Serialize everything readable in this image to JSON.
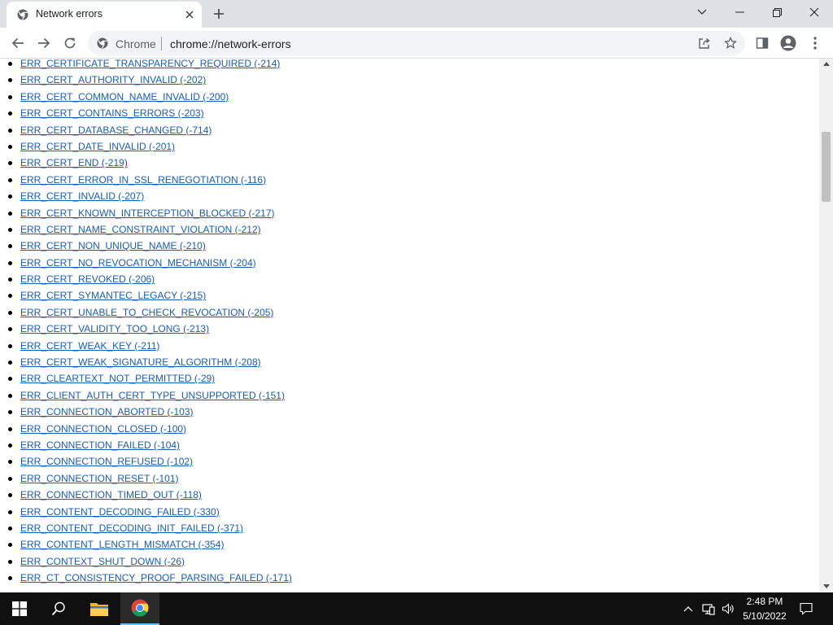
{
  "tab": {
    "title": "Network errors"
  },
  "toolbar": {
    "scheme_label": "Chrome",
    "url": "chrome://network-errors"
  },
  "errors": [
    "ERR_CERTIFICATE_TRANSPARENCY_REQUIRED (-214)",
    "ERR_CERT_AUTHORITY_INVALID (-202)",
    "ERR_CERT_COMMON_NAME_INVALID (-200)",
    "ERR_CERT_CONTAINS_ERRORS (-203)",
    "ERR_CERT_DATABASE_CHANGED (-714)",
    "ERR_CERT_DATE_INVALID (-201)",
    "ERR_CERT_END (-219)",
    "ERR_CERT_ERROR_IN_SSL_RENEGOTIATION (-116)",
    "ERR_CERT_INVALID (-207)",
    "ERR_CERT_KNOWN_INTERCEPTION_BLOCKED (-217)",
    "ERR_CERT_NAME_CONSTRAINT_VIOLATION (-212)",
    "ERR_CERT_NON_UNIQUE_NAME (-210)",
    "ERR_CERT_NO_REVOCATION_MECHANISM (-204)",
    "ERR_CERT_REVOKED (-206)",
    "ERR_CERT_SYMANTEC_LEGACY (-215)",
    "ERR_CERT_UNABLE_TO_CHECK_REVOCATION (-205)",
    "ERR_CERT_VALIDITY_TOO_LONG (-213)",
    "ERR_CERT_WEAK_KEY (-211)",
    "ERR_CERT_WEAK_SIGNATURE_ALGORITHM (-208)",
    "ERR_CLEARTEXT_NOT_PERMITTED (-29)",
    "ERR_CLIENT_AUTH_CERT_TYPE_UNSUPPORTED (-151)",
    "ERR_CONNECTION_ABORTED (-103)",
    "ERR_CONNECTION_CLOSED (-100)",
    "ERR_CONNECTION_FAILED (-104)",
    "ERR_CONNECTION_REFUSED (-102)",
    "ERR_CONNECTION_RESET (-101)",
    "ERR_CONNECTION_TIMED_OUT (-118)",
    "ERR_CONTENT_DECODING_FAILED (-330)",
    "ERR_CONTENT_DECODING_INIT_FAILED (-371)",
    "ERR_CONTENT_LENGTH_MISMATCH (-354)",
    "ERR_CONTEXT_SHUT_DOWN (-26)",
    "ERR_CT_CONSISTENCY_PROOF_PARSING_FAILED (-171)"
  ],
  "taskbar": {
    "time": "2:48 PM",
    "date": "5/10/2022"
  },
  "colors": {
    "link": "#1a5bb5",
    "tabstrip": "#dee1e6",
    "omnibox": "#f1f3f4",
    "taskbar": "#101010"
  }
}
